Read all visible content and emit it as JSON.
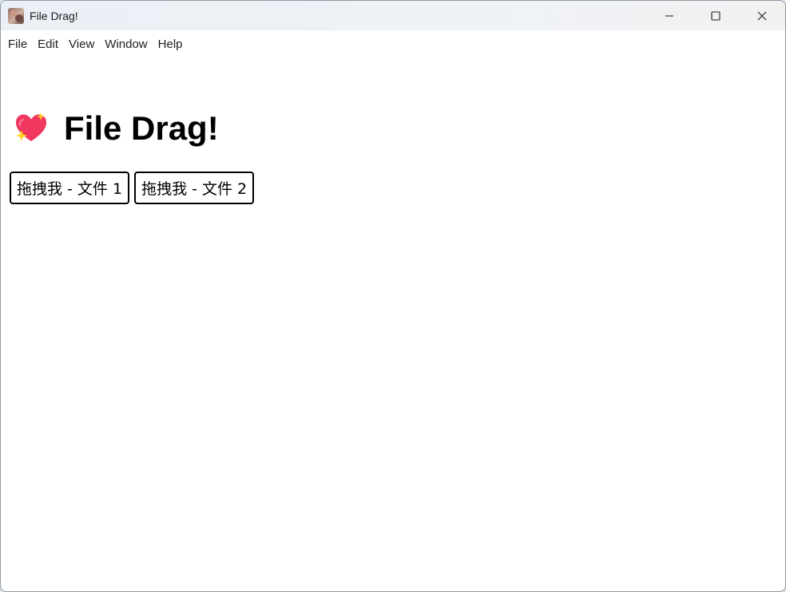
{
  "window": {
    "title": "File Drag!",
    "app_icon": "app-photo-icon",
    "controls": [
      "minimize-icon",
      "maximize-icon",
      "close-icon"
    ]
  },
  "menu": {
    "items": [
      {
        "label": "File"
      },
      {
        "label": "Edit"
      },
      {
        "label": "View"
      },
      {
        "label": "Window"
      },
      {
        "label": "Help"
      }
    ]
  },
  "main": {
    "heading": {
      "icon": "sparkling-heart-icon",
      "text": "File Drag!"
    },
    "buttons": [
      {
        "label": "拖拽我 - 文件 1"
      },
      {
        "label": "拖拽我 - 文件 2"
      }
    ]
  },
  "colors": {
    "heart": "#f0375f",
    "sparkle": "#ffd21f",
    "button_border": "#000000",
    "background": "#ffffff"
  }
}
